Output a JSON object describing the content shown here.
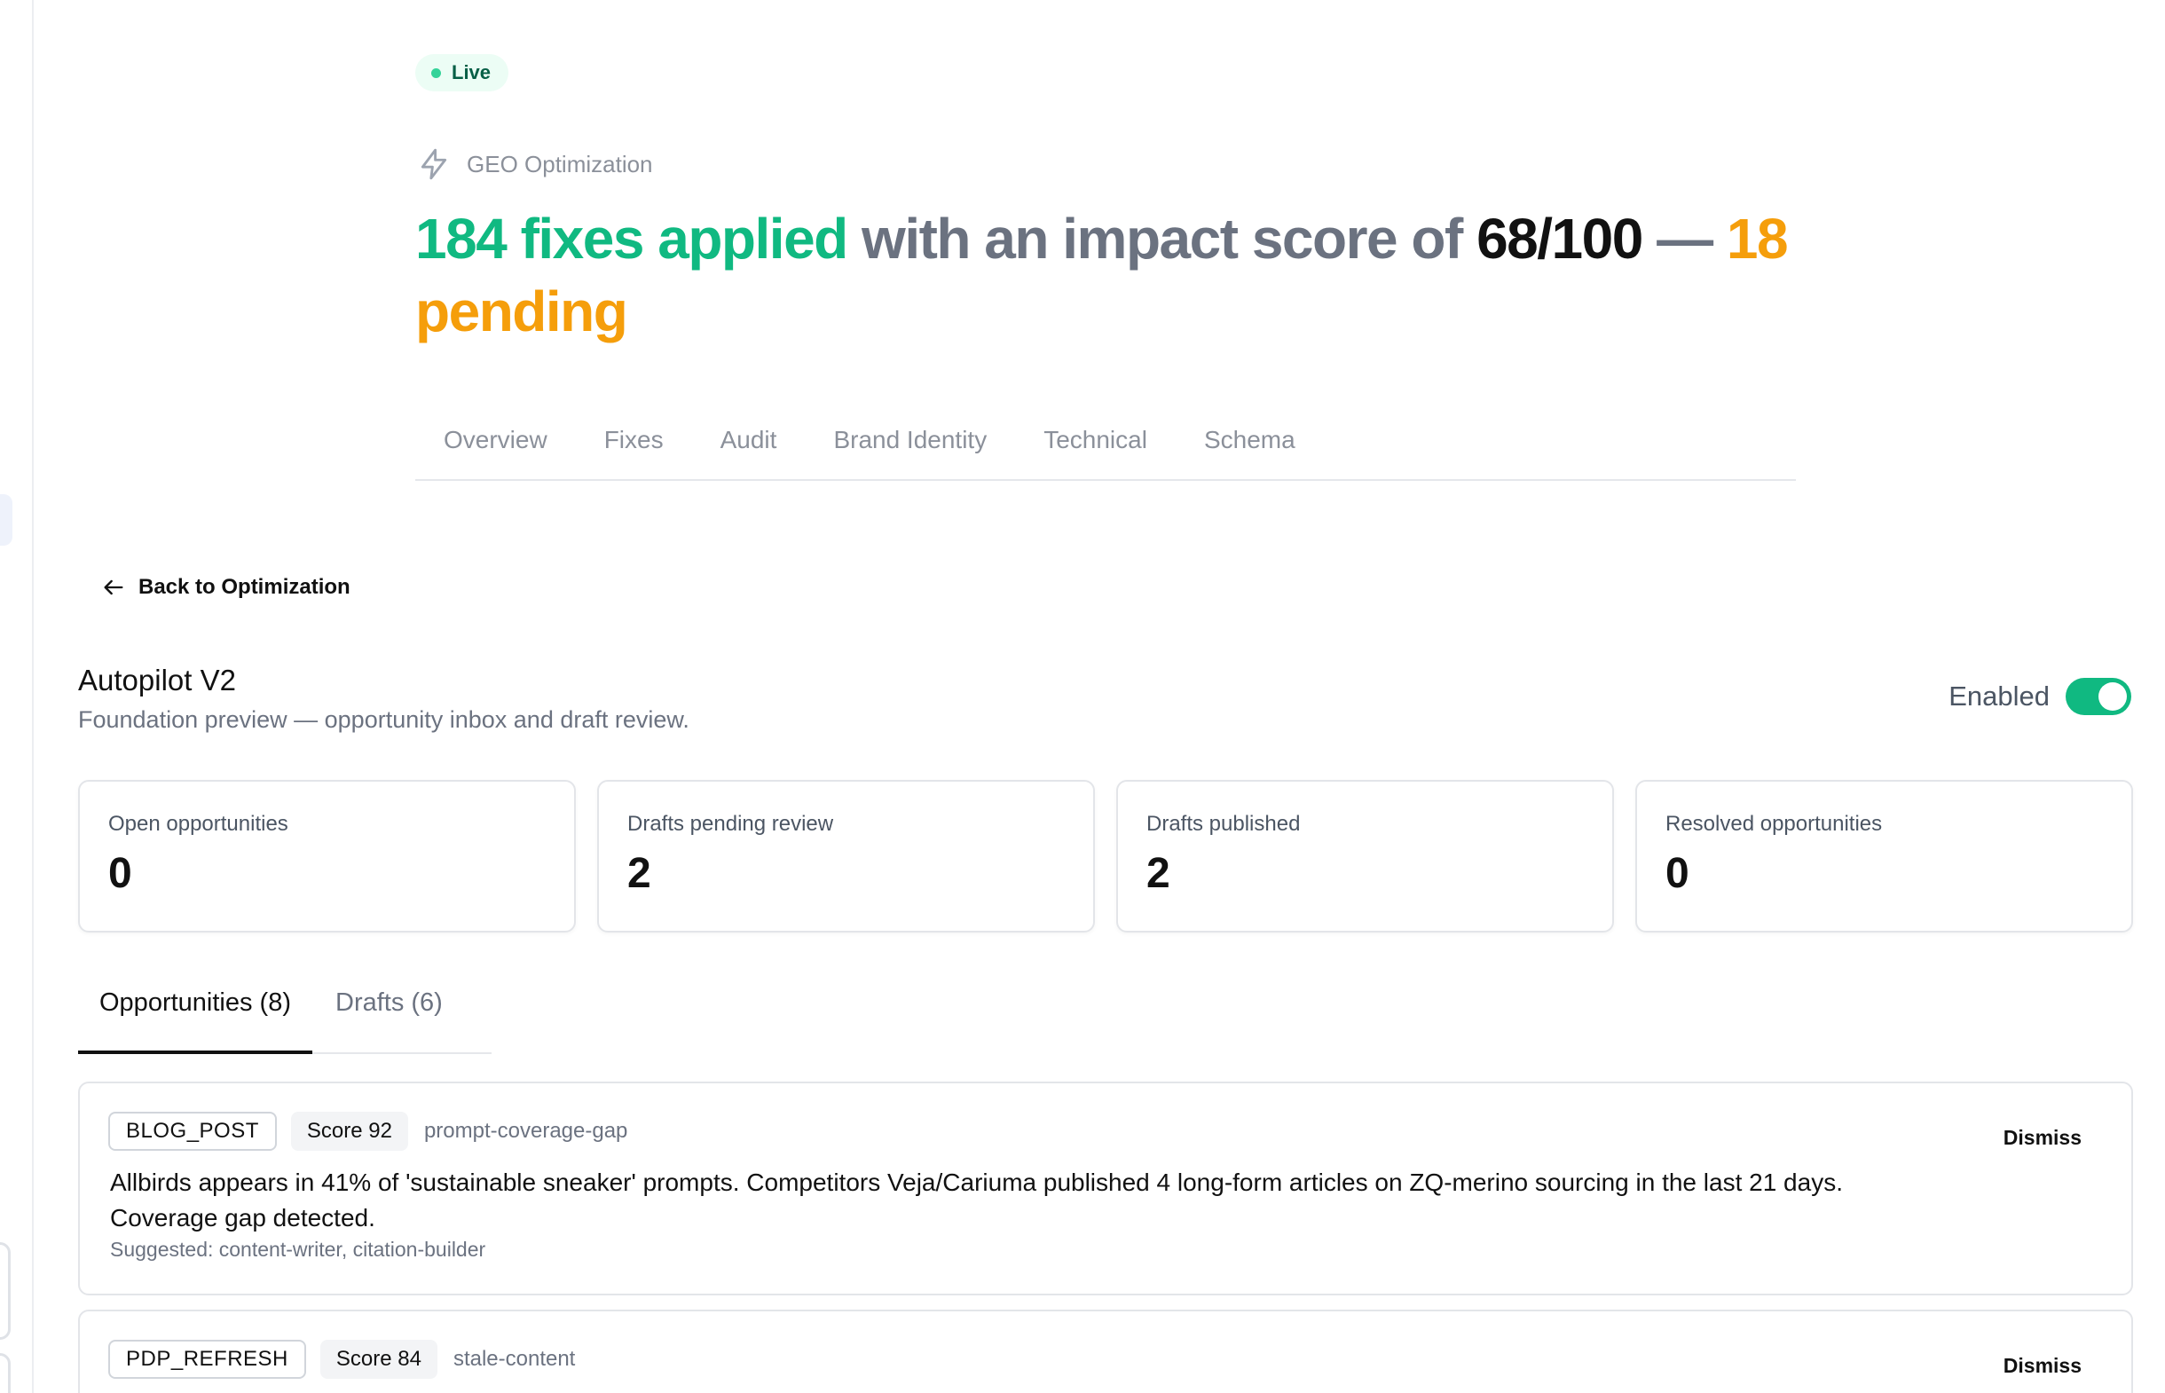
{
  "status": {
    "label": "Live"
  },
  "header": {
    "section": "GEO Optimization",
    "headline": {
      "fixes": "184 fixes applied",
      "middle": " with an impact score of ",
      "score": "68/100",
      "dash": " — ",
      "pending": "18 pending"
    }
  },
  "top_tabs": [
    "Overview",
    "Fixes",
    "Audit",
    "Brand Identity",
    "Technical",
    "Schema"
  ],
  "back_link": "Back to Optimization",
  "page": {
    "title": "Autopilot V2",
    "subtitle": "Foundation preview — opportunity inbox and draft review.",
    "toggle_label": "Enabled",
    "toggle_on": true
  },
  "stats": [
    {
      "label": "Open opportunities",
      "value": "0"
    },
    {
      "label": "Drafts pending review",
      "value": "2"
    },
    {
      "label": "Drafts published",
      "value": "2"
    },
    {
      "label": "Resolved opportunities",
      "value": "0"
    }
  ],
  "sub_tabs": [
    {
      "label": "Opportunities (8)",
      "active": true
    },
    {
      "label": "Drafts (6)",
      "active": false
    }
  ],
  "opportunities": [
    {
      "type": "BLOG_POST",
      "score": "Score 92",
      "tag": "prompt-coverage-gap",
      "body": "Allbirds appears in 41% of 'sustainable sneaker' prompts. Competitors Veja/Cariuma published 4 long-form articles on ZQ-merino sourcing in the last 21 days. Coverage gap detected.",
      "suggested": "Suggested: content-writer, citation-builder",
      "action": "Dismiss"
    },
    {
      "type": "PDP_REFRESH",
      "score": "Score 84",
      "tag": "stale-content",
      "action": "Dismiss"
    }
  ],
  "colors": {
    "accent_green": "#10b981",
    "accent_amber": "#f59e0b",
    "muted": "#6b7280"
  },
  "icons": {
    "section": "lightning-bolt-icon",
    "back": "arrow-left-icon"
  }
}
